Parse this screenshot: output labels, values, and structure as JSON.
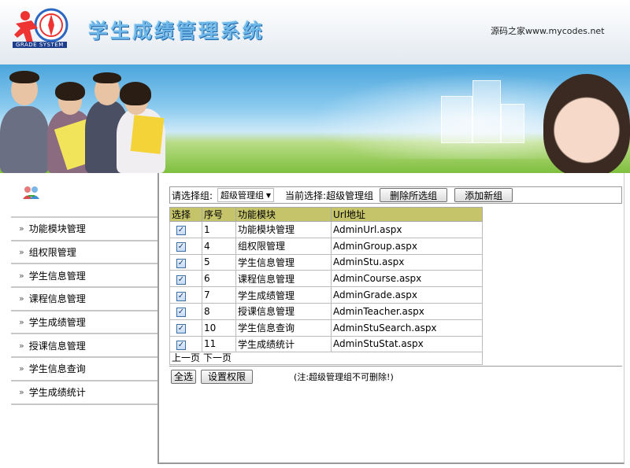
{
  "header": {
    "logo_text": "GRADE SYSTEM",
    "title": "学生成绩管理系统",
    "site_link": "源码之家www.mycodes.net"
  },
  "sidebar": {
    "items": [
      {
        "label": "功能模块管理"
      },
      {
        "label": "组权限管理"
      },
      {
        "label": "学生信息管理"
      },
      {
        "label": "课程信息管理"
      },
      {
        "label": "学生成绩管理"
      },
      {
        "label": "授课信息管理"
      },
      {
        "label": "学生信息查询"
      },
      {
        "label": "学生成绩统计"
      }
    ]
  },
  "toolbar": {
    "select_label": "请选择组:",
    "select_value": "超级管理组",
    "current_label": "当前选择:超级管理组",
    "delete_button": "删除所选组",
    "add_button": "添加新组"
  },
  "table": {
    "headers": [
      "选择",
      "序号",
      "功能模块",
      "Url地址"
    ],
    "rows": [
      {
        "id": "1",
        "module": "功能模块管理",
        "url": "AdminUrl.aspx"
      },
      {
        "id": "4",
        "module": "组权限管理",
        "url": "AdminGroup.aspx"
      },
      {
        "id": "5",
        "module": "学生信息管理",
        "url": "AdminStu.aspx"
      },
      {
        "id": "6",
        "module": "课程信息管理",
        "url": "AdminCourse.aspx"
      },
      {
        "id": "7",
        "module": "学生成绩管理",
        "url": "AdminGrade.aspx"
      },
      {
        "id": "8",
        "module": "授课信息管理",
        "url": "AdminTeacher.aspx"
      },
      {
        "id": "10",
        "module": "学生信息查询",
        "url": "AdminStuSearch.aspx"
      },
      {
        "id": "11",
        "module": "学生成绩统计",
        "url": "AdminStuStat.aspx"
      }
    ],
    "checkbox_mark": "✓"
  },
  "pager": {
    "prev": "上一页",
    "next": "下一页"
  },
  "actions": {
    "select_all": "全选",
    "set_permission": "设置权限",
    "note": "(注:超级管理组不可删除!)"
  },
  "colors": {
    "header_row": "#c5c46a",
    "title_blue": "#6fb8e8"
  }
}
